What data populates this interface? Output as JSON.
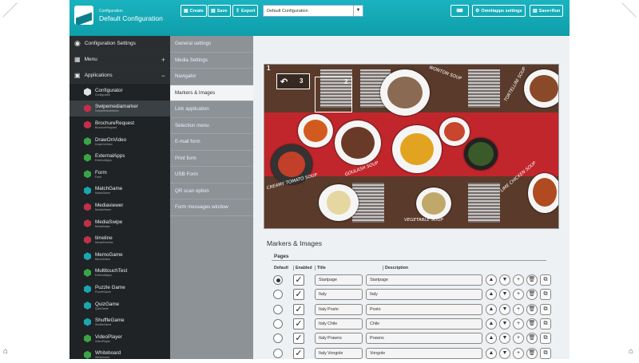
{
  "header": {
    "subtitle": "Configuration",
    "title": "Default Configuration",
    "create_label": "Create",
    "save_label": "Save",
    "export_label": "Export",
    "config_select_value": "Default Configuration",
    "omnitapps_settings_label": "Omnitapps settings",
    "save_run_label": "Save+Run"
  },
  "sidebar": {
    "configuration_settings": "Configuration Settings",
    "menu": "Menu",
    "applications": "Applications",
    "items": [
      {
        "label": "Configurator",
        "sub": "Configurator",
        "color": "#e0e0e0"
      },
      {
        "label": "Swipemediamarker",
        "sub": "SwipeMediaMarker",
        "color": "#c0304a"
      },
      {
        "label": "BrochureRequest",
        "sub": "BrochureRequest",
        "color": "#c0304a"
      },
      {
        "label": "DrawOnVideo",
        "sub": "DrawOnVideo",
        "color": "#3aa544"
      },
      {
        "label": "ExternalApps",
        "sub": "ExternalApps",
        "color": "#3aa544"
      },
      {
        "label": "Form",
        "sub": "Form",
        "color": "#3aa544"
      },
      {
        "label": "MatchGame",
        "sub": "MatchGame",
        "color": "#1aa5b0"
      },
      {
        "label": "Mediaviewer",
        "sub": "MediaViewer",
        "color": "#c0304a"
      },
      {
        "label": "MediaSwipe",
        "sub": "MediaSwipe",
        "color": "#c0304a"
      },
      {
        "label": "timeline",
        "sub": "MediaTimeline",
        "color": "#c0304a"
      },
      {
        "label": "MemoGame",
        "sub": "MemoGame",
        "color": "#1aa5b0"
      },
      {
        "label": "MultitouchTest",
        "sub": "ExternalApps",
        "color": "#3aa544"
      },
      {
        "label": "Puzzle Game",
        "sub": "PuzzleGame",
        "color": "#1aa5b0"
      },
      {
        "label": "QuizGame",
        "sub": "QuizGame",
        "color": "#1aa5b0"
      },
      {
        "label": "ShuffleGame",
        "sub": "ShuffleGame",
        "color": "#1aa5b0"
      },
      {
        "label": "VideoPlayer",
        "sub": "VideoPlayer",
        "color": "#3aa544"
      },
      {
        "label": "Whiteboard",
        "sub": "Whiteboard",
        "color": "#3aa544"
      }
    ]
  },
  "subnav": [
    "General settings",
    "Media Settings",
    "Navigator",
    "Markers & Images",
    "Link application",
    "Selection menu",
    "E-mail form",
    "Print form",
    "USB Form",
    "QR scan option",
    "Form messages window"
  ],
  "preview": {
    "marker1": "1",
    "marker2": "2",
    "marker3": "3",
    "annotations": [
      "WONTON SOUP",
      "TORTELLINI SOUP",
      "GOULASH SOUP",
      "CREAMY TOMATO SOUP",
      "LIME CHICKEN SOUP",
      "VEGETABLE SOUP"
    ]
  },
  "section": {
    "title": "Markers & Images",
    "pages_label": "Pages",
    "col_default": "Default",
    "col_enabled": "Enabled",
    "col_title": "Title",
    "col_description": "Description"
  },
  "rows": [
    {
      "title": "Startpage",
      "description": "Startpage",
      "default": true
    },
    {
      "title": "Italy",
      "description": "Italy",
      "default": false
    },
    {
      "title": "Italy Posto",
      "description": "Posto",
      "default": false
    },
    {
      "title": "Italy Chile",
      "description": "Chile",
      "default": false
    },
    {
      "title": "Italy Prawns",
      "description": "Prawns",
      "default": false
    },
    {
      "title": "Italy Vongole",
      "description": "Vongole",
      "default": false
    }
  ]
}
